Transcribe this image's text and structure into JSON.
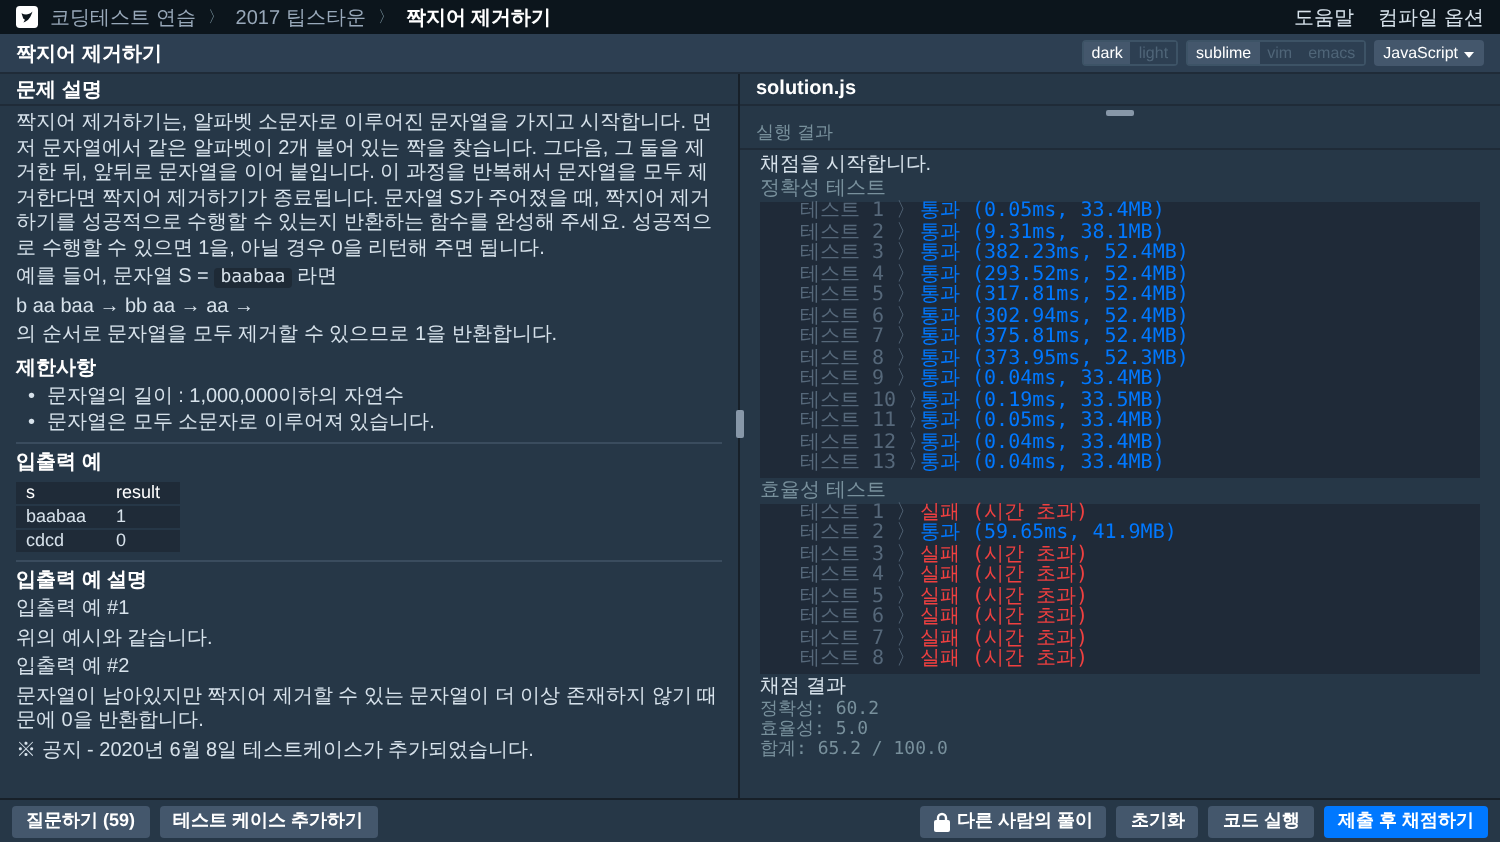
{
  "nav": {
    "breadcrumbs": [
      "코딩테스트 연습",
      "2017 팁스타운"
    ],
    "separator": "〉",
    "page": "짝지어 제거하기",
    "links": [
      "도움말",
      "컴파일 옵션"
    ]
  },
  "title": "짝지어 제거하기",
  "problem": {
    "header": "문제 설명",
    "description": "짝지어 제거하기는, 알파벳 소문자로 이루어진 문자열을 가지고 시작합니다. 먼저 문자열에서 같은 알파벳이 2개 붙어 있는 짝을 찾습니다. 그다음, 그 둘을 제거한 뒤, 앞뒤로 문자열을 이어 붙입니다. 이 과정을 반복해서 문자열을 모두 제거한다면 짝지어 제거하기가 종료됩니다. 문자열 S가 주어졌을 때, 짝지어 제거하기를 성공적으로 수행할 수 있는지 반환하는 함수를 완성해 주세요. 성공적으로 수행할 수 있으면 1을, 아닐 경우 0을 리턴해 주면 됩니다.",
    "example_prefix": "예를 들어, 문자열 S =",
    "example_code": "baabaa",
    "example_suffix": "라면",
    "steps": "b aa baa → bb aa → aa →",
    "conclusion": "의 순서로 문자열을 모두 제거할 수 있으므로 1을 반환합니다.",
    "constraints_title": "제한사항",
    "bullet": "•",
    "constraints": [
      "문자열의 길이 : 1,000,000이하의 자연수",
      "문자열은 모두 소문자로 이루어져 있습니다."
    ],
    "io_title": "입출력 예",
    "io_columns": [
      "s",
      "result"
    ],
    "io_rows": [
      [
        "baabaa",
        "1"
      ],
      [
        "cdcd",
        "0"
      ]
    ],
    "explain_title": "입출력 예 설명",
    "explain_lines": [
      "입출력 예 #1",
      "위의 예시와 같습니다.",
      "입출력 예 #2",
      "문자열이 남아있지만 짝지어 제거할 수 있는 문자열이 더 이상 존재하지 않기 때문에 0을 반환합니다."
    ],
    "notice": "※ 공지 - 2020년 6월 8일 테스트케이스가 추가되었습니다."
  },
  "editor": {
    "themes": [
      {
        "label": "dark",
        "selected": true
      },
      {
        "label": "light",
        "selected": false
      }
    ],
    "keymaps": [
      {
        "label": "sublime",
        "selected": true
      },
      {
        "label": "vim",
        "selected": false
      },
      {
        "label": "emacs",
        "selected": false
      }
    ],
    "language": "JavaScript",
    "file": "solution.js"
  },
  "results": {
    "header": "실행 결과",
    "start": "채점을 시작합니다.",
    "groups": [
      {
        "title": "정확성  테스트",
        "tests": [
          {
            "label": "테스트 1",
            "passed": true,
            "result": "통과 (0.05ms, 33.4MB)"
          },
          {
            "label": "테스트 2",
            "passed": true,
            "result": "통과 (9.31ms, 38.1MB)"
          },
          {
            "label": "테스트 3",
            "passed": true,
            "result": "통과 (382.23ms, 52.4MB)"
          },
          {
            "label": "테스트 4",
            "passed": true,
            "result": "통과 (293.52ms, 52.4MB)"
          },
          {
            "label": "테스트 5",
            "passed": true,
            "result": "통과 (317.81ms, 52.4MB)"
          },
          {
            "label": "테스트 6",
            "passed": true,
            "result": "통과 (302.94ms, 52.4MB)"
          },
          {
            "label": "테스트 7",
            "passed": true,
            "result": "통과 (375.81ms, 52.4MB)"
          },
          {
            "label": "테스트 8",
            "passed": true,
            "result": "통과 (373.95ms, 52.3MB)"
          },
          {
            "label": "테스트 9",
            "passed": true,
            "result": "통과 (0.04ms, 33.4MB)"
          },
          {
            "label": "테스트 10",
            "passed": true,
            "result": "통과 (0.19ms, 33.5MB)"
          },
          {
            "label": "테스트 11",
            "passed": true,
            "result": "통과 (0.05ms, 33.4MB)"
          },
          {
            "label": "테스트 12",
            "passed": true,
            "result": "통과 (0.04ms, 33.4MB)"
          },
          {
            "label": "테스트 13",
            "passed": true,
            "result": "통과 (0.04ms, 33.4MB)"
          }
        ]
      },
      {
        "title": "효율성  테스트",
        "tests": [
          {
            "label": "테스트 1",
            "passed": false,
            "result": "실패 (시간 초과)"
          },
          {
            "label": "테스트 2",
            "passed": true,
            "result": "통과 (59.65ms, 41.9MB)"
          },
          {
            "label": "테스트 3",
            "passed": false,
            "result": "실패 (시간 초과)"
          },
          {
            "label": "테스트 4",
            "passed": false,
            "result": "실패 (시간 초과)"
          },
          {
            "label": "테스트 5",
            "passed": false,
            "result": "실패 (시간 초과)"
          },
          {
            "label": "테스트 6",
            "passed": false,
            "result": "실패 (시간 초과)"
          },
          {
            "label": "테스트 7",
            "passed": false,
            "result": "실패 (시간 초과)"
          },
          {
            "label": "테스트 8",
            "passed": false,
            "result": "실패 (시간 초과)"
          }
        ]
      }
    ],
    "arrow": "〉",
    "summary_title": "채점 결과",
    "summary": [
      "정확성: 60.2",
      "효율성: 5.0",
      "합계: 65.2 / 100.0"
    ]
  },
  "footer": {
    "left": [
      "질문하기 (59)",
      "테스트 케이스 추가하기"
    ],
    "right": [
      {
        "label": "다른 사람의 풀이",
        "kind": "locked"
      },
      {
        "label": "초기화",
        "kind": "plain"
      },
      {
        "label": "코드 실행",
        "kind": "plain"
      },
      {
        "label": "제출 후 채점하기",
        "kind": "primary"
      }
    ]
  }
}
